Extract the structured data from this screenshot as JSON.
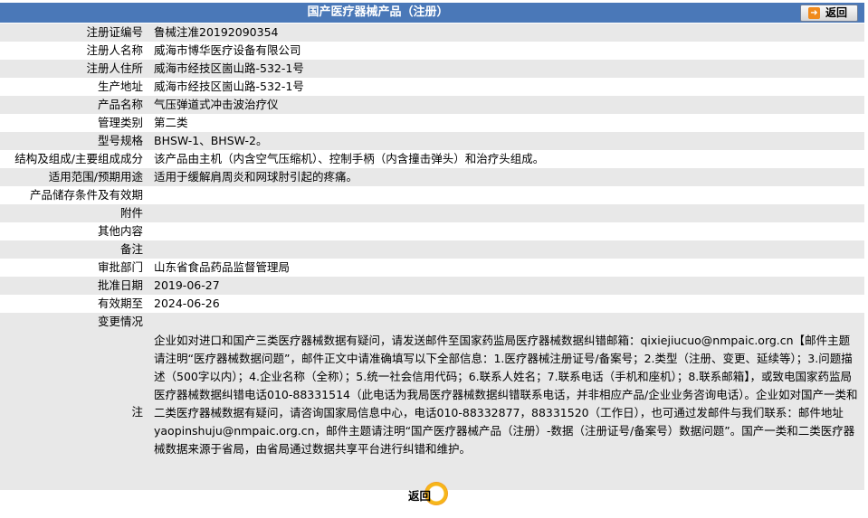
{
  "header": {
    "title": "国产医疗器械产品（注册）",
    "back_label": "返回"
  },
  "fields": [
    {
      "label": "注册证编号",
      "value": "鲁械注准20192090354"
    },
    {
      "label": "注册人名称",
      "value": "威海市博华医疗设备有限公司"
    },
    {
      "label": "注册人住所",
      "value": "威海市经技区崮山路-532-1号"
    },
    {
      "label": "生产地址",
      "value": "威海市经技区崮山路-532-1号"
    },
    {
      "label": "产品名称",
      "value": "气压弹道式冲击波治疗仪"
    },
    {
      "label": "管理类别",
      "value": "第二类"
    },
    {
      "label": "型号规格",
      "value": "BHSW-1、BHSW-2。"
    },
    {
      "label": "结构及组成/主要组成成分",
      "value": "该产品由主机（内含空气压缩机）、控制手柄（内含撞击弹头）和治疗头组成。"
    },
    {
      "label": "适用范围/预期用途",
      "value": "适用于缓解肩周炎和网球肘引起的疼痛。"
    },
    {
      "label": "产品储存条件及有效期",
      "value": ""
    },
    {
      "label": "附件",
      "value": ""
    },
    {
      "label": "其他内容",
      "value": ""
    },
    {
      "label": "备注",
      "value": ""
    },
    {
      "label": "审批部门",
      "value": "山东省食品药品监督管理局"
    },
    {
      "label": "批准日期",
      "value": "2019-06-27"
    },
    {
      "label": "有效期至",
      "value": "2024-06-26"
    },
    {
      "label": "变更情况",
      "value": ""
    }
  ],
  "note": {
    "label": "注",
    "text": "企业如对进口和国产三类医疗器械数据有疑问，请发送邮件至国家药监局医疗器械数据纠错邮箱：qixiejiucuo@nmpaic.org.cn【邮件主题请注明“医疗器械数据问题”，邮件正文中请准确填写以下全部信息：1.医疗器械注册证号/备案号；2.类型（注册、变更、延续等）；3.问题描述（500字以内）；4.企业名称（全称）；5.统一社会信用代码；6.联系人姓名；7.联系电话（手机和座机）；8.联系邮箱】，或致电国家药监局医疗器械数据纠错电话010-88331514（此电话为我局医疗器械数据纠错联系电话，并非相应产品/企业业务咨询电话）。企业如对国产一类和二类医疗器械数据有疑问，请咨询国家局信息中心，电话010-88332877，88331520（工作日），也可通过发邮件与我们联系：邮件地址yaopinshuju@nmpaic.org.cn，邮件主题请注明“国产医疗器械产品（注册）-数据（注册证号/备案号）数据问题”。国产一类和二类医疗器械数据来源于省局，由省局通过数据共享平台进行纠错和维护。"
  },
  "footer": {
    "back_label": "返回"
  },
  "colors": {
    "header_bg": "#4a78b8",
    "row_gray": "#e8e8e8",
    "accent": "#f08a1c"
  }
}
